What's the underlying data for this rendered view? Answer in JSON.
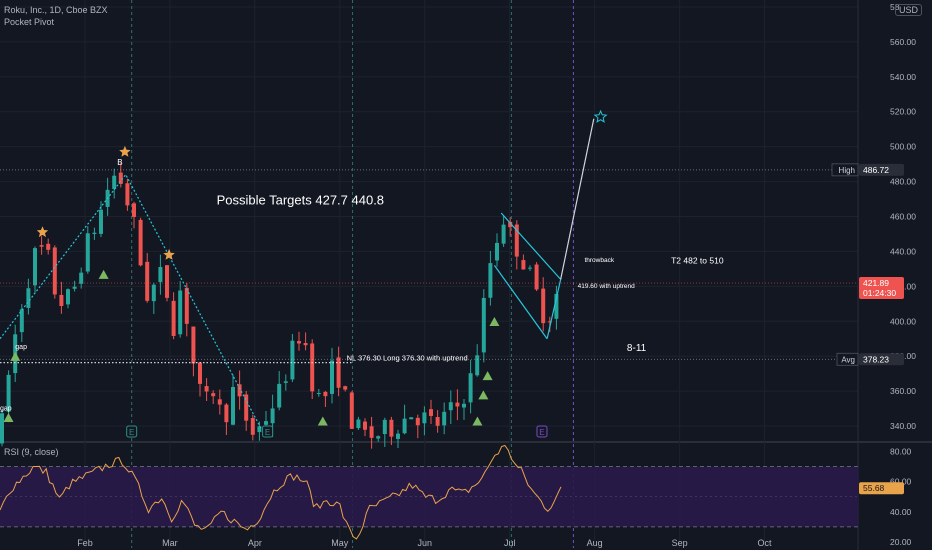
{
  "header": {
    "symbol_line": "Roku, Inc., 1D, Cboe BZX",
    "indicator_name": "Pocket Pivot",
    "currency": "USD",
    "rsi_legend": "RSI (9, close)"
  },
  "colors": {
    "background": "#131722",
    "up": "#26a69a",
    "down": "#ef5350",
    "rsi_line": "#e9a34b",
    "rsi_band": "#2a1a4a",
    "trendline": "#26c6da",
    "projection": "#d1d4dc",
    "star": "#e9a34b",
    "triangle": "#7cb862"
  },
  "chart_data": [
    {
      "type": "candlestick",
      "title": "Roku, Inc., 1D, Cboe BZX",
      "x_ticks": [
        "Feb",
        "Mar",
        "Apr",
        "May",
        "Jun",
        "Jul",
        "Aug",
        "Sep",
        "Oct"
      ],
      "y_ticks": [
        340,
        360,
        380,
        400,
        420,
        440,
        460,
        480,
        500,
        520,
        540,
        560,
        580
      ],
      "y_tick_labels": [
        "340.00",
        "360.00",
        "380.00",
        "400.00",
        "420.00",
        "440.00",
        "460.00",
        "480.00",
        "500.00",
        "520.00",
        "540.00",
        "560.00",
        "58"
      ],
      "ylim": [
        332,
        584
      ],
      "x_range_months": [
        0,
        10.1
      ],
      "pivots": [
        {
          "t": 0.0,
          "p": 332
        },
        {
          "t": 0.05,
          "p": 352
        },
        {
          "t": 0.12,
          "p": 375
        },
        {
          "t": 0.2,
          "p": 398
        },
        {
          "t": 0.3,
          "p": 420
        },
        {
          "t": 0.38,
          "p": 432
        },
        {
          "t": 0.46,
          "p": 446
        },
        {
          "t": 0.53,
          "p": 432
        },
        {
          "t": 0.6,
          "p": 438
        },
        {
          "t": 0.68,
          "p": 402
        },
        {
          "t": 0.76,
          "p": 420
        },
        {
          "t": 0.83,
          "p": 408
        },
        {
          "t": 0.9,
          "p": 425
        },
        {
          "t": 0.98,
          "p": 438
        },
        {
          "t": 1.08,
          "p": 450
        },
        {
          "t": 1.18,
          "p": 462
        },
        {
          "t": 1.28,
          "p": 478
        },
        {
          "t": 1.38,
          "p": 486
        },
        {
          "t": 1.48,
          "p": 472
        },
        {
          "t": 1.58,
          "p": 454
        },
        {
          "t": 1.66,
          "p": 432
        },
        {
          "t": 1.74,
          "p": 414
        },
        {
          "t": 1.84,
          "p": 422
        },
        {
          "t": 1.92,
          "p": 428
        },
        {
          "t": 2.0,
          "p": 408
        },
        {
          "t": 2.06,
          "p": 395
        },
        {
          "t": 2.12,
          "p": 418
        },
        {
          "t": 2.2,
          "p": 402
        },
        {
          "t": 2.3,
          "p": 368
        },
        {
          "t": 2.4,
          "p": 350
        },
        {
          "t": 2.52,
          "p": 362
        },
        {
          "t": 2.62,
          "p": 342
        },
        {
          "t": 2.74,
          "p": 360
        },
        {
          "t": 2.86,
          "p": 348
        },
        {
          "t": 2.98,
          "p": 336
        },
        {
          "t": 3.08,
          "p": 340
        },
        {
          "t": 3.2,
          "p": 352
        },
        {
          "t": 3.3,
          "p": 360
        },
        {
          "t": 3.42,
          "p": 380
        },
        {
          "t": 3.52,
          "p": 392
        },
        {
          "t": 3.6,
          "p": 386
        },
        {
          "t": 3.7,
          "p": 360
        },
        {
          "t": 3.8,
          "p": 352
        },
        {
          "t": 3.9,
          "p": 372
        },
        {
          "t": 4.0,
          "p": 368
        },
        {
          "t": 4.1,
          "p": 348
        },
        {
          "t": 4.2,
          "p": 338
        },
        {
          "t": 4.35,
          "p": 334
        },
        {
          "t": 4.5,
          "p": 336
        },
        {
          "t": 4.7,
          "p": 342
        },
        {
          "t": 4.85,
          "p": 348
        },
        {
          "t": 5.0,
          "p": 344
        },
        {
          "t": 5.12,
          "p": 340
        },
        {
          "t": 5.25,
          "p": 346
        },
        {
          "t": 5.4,
          "p": 352
        },
        {
          "t": 5.55,
          "p": 368
        },
        {
          "t": 5.65,
          "p": 392
        },
        {
          "t": 5.75,
          "p": 430
        },
        {
          "t": 5.85,
          "p": 448
        },
        {
          "t": 5.93,
          "p": 460
        },
        {
          "t": 6.03,
          "p": 446
        },
        {
          "t": 6.12,
          "p": 440
        },
        {
          "t": 6.2,
          "p": 430
        },
        {
          "t": 6.28,
          "p": 420
        },
        {
          "t": 6.36,
          "p": 410
        },
        {
          "t": 6.44,
          "p": 400
        },
        {
          "t": 6.52,
          "p": 412
        },
        {
          "t": 6.6,
          "p": 420
        }
      ],
      "price_lines": [
        {
          "value": 486.72,
          "label": "High",
          "price_label": "486.72",
          "color": "#d1d4dc",
          "bg": "#131722",
          "style": "dotted"
        },
        {
          "value": 421.89,
          "label": "",
          "price_label": "421.89",
          "sub_label": "01:24:30",
          "color": "#ef5350",
          "bg": "#ef5350",
          "style": "dotted"
        },
        {
          "value": 378.23,
          "label": "Avg",
          "price_label": "378.23",
          "color": "#d1d4dc",
          "bg": "#131722",
          "style": "dotted"
        }
      ],
      "earnings_markers": [
        {
          "t": 1.55,
          "label": "E"
        },
        {
          "t": 3.15,
          "label": "E"
        },
        {
          "t": 6.38,
          "label": "E"
        }
      ],
      "vertical_dashed_t": [
        1.55,
        4.15,
        6.02,
        6.75
      ],
      "neckline": {
        "value": 376.3,
        "t_start": 0.0,
        "t_end": 4.15
      },
      "trend_lines": [
        {
          "points": [
            [
              0.0,
              390
            ],
            [
              1.48,
              484
            ],
            [
              3.08,
              338
            ]
          ]
        },
        {
          "points": [
            [
              5.9,
              462
            ],
            [
              6.6,
              424
            ]
          ]
        },
        {
          "points": [
            [
              5.82,
              432
            ],
            [
              6.44,
              390
            ]
          ]
        },
        {
          "points": [
            [
              6.44,
              390
            ],
            [
              6.6,
              424
            ]
          ]
        }
      ],
      "projection_line": {
        "points": [
          [
            6.6,
            424
          ],
          [
            6.99,
            516
          ]
        ]
      },
      "stars": [
        {
          "t": 0.5,
          "p": 451
        },
        {
          "t": 1.47,
          "p": 497
        },
        {
          "t": 1.99,
          "p": 438
        },
        {
          "t": 7.07,
          "p": 517,
          "hollow": true
        }
      ],
      "triangles": [
        {
          "t": 0.1,
          "p": 344
        },
        {
          "t": 0.18,
          "p": 379
        },
        {
          "t": 1.22,
          "p": 426
        },
        {
          "t": 3.8,
          "p": 342
        },
        {
          "t": 5.62,
          "p": 342
        },
        {
          "t": 5.69,
          "p": 357
        },
        {
          "t": 5.74,
          "p": 368
        },
        {
          "t": 5.82,
          "p": 399
        }
      ],
      "annotations": [
        {
          "text": "Possible Targets  427.7   440.8",
          "t": 2.55,
          "p": 467,
          "size": 13
        },
        {
          "text": "T2  482 to 510",
          "t": 7.9,
          "p": 433,
          "size": 8.5
        },
        {
          "text": "throwback",
          "t": 6.88,
          "p": 434,
          "size": 6.5
        },
        {
          "text": "419.60 with uptrend",
          "t": 6.8,
          "p": 419,
          "size": 6.5
        },
        {
          "text": "NL 376.30  Long 376.30 with uptrend",
          "t": 4.08,
          "p": 377.5,
          "size": 7.5
        },
        {
          "text": "8-11",
          "t": 7.38,
          "p": 383,
          "size": 10
        },
        {
          "text": "B",
          "t": 1.38,
          "p": 489.5,
          "size": 8
        },
        {
          "text": "gap",
          "t": 0.18,
          "p": 384,
          "size": 7
        },
        {
          "text": "gap",
          "t": 0.0,
          "p": 349,
          "size": 7
        }
      ]
    },
    {
      "type": "line",
      "title": "RSI (9, close)",
      "ylim": [
        16,
        85
      ],
      "y_ticks": [
        20,
        40,
        60,
        80
      ],
      "y_tick_labels": [
        "20.00",
        "40.00",
        "60.00",
        "80.00"
      ],
      "bands": [
        30,
        70
      ],
      "current_value": 55.68,
      "current_label": "55.68",
      "pivots": [
        {
          "t": 0.0,
          "p": 40
        },
        {
          "t": 0.12,
          "p": 55
        },
        {
          "t": 0.25,
          "p": 62
        },
        {
          "t": 0.4,
          "p": 70
        },
        {
          "t": 0.55,
          "p": 66
        },
        {
          "t": 0.7,
          "p": 48
        },
        {
          "t": 0.82,
          "p": 58
        },
        {
          "t": 0.95,
          "p": 62
        },
        {
          "t": 1.1,
          "p": 66
        },
        {
          "t": 1.3,
          "p": 72
        },
        {
          "t": 1.45,
          "p": 74
        },
        {
          "t": 1.6,
          "p": 60
        },
        {
          "t": 1.75,
          "p": 42
        },
        {
          "t": 1.9,
          "p": 50
        },
        {
          "t": 2.02,
          "p": 36
        },
        {
          "t": 2.15,
          "p": 48
        },
        {
          "t": 2.3,
          "p": 30
        },
        {
          "t": 2.45,
          "p": 28
        },
        {
          "t": 2.6,
          "p": 40
        },
        {
          "t": 2.75,
          "p": 34
        },
        {
          "t": 2.9,
          "p": 28
        },
        {
          "t": 3.05,
          "p": 36
        },
        {
          "t": 3.2,
          "p": 52
        },
        {
          "t": 3.32,
          "p": 60
        },
        {
          "t": 3.45,
          "p": 64
        },
        {
          "t": 3.6,
          "p": 60
        },
        {
          "t": 3.72,
          "p": 42
        },
        {
          "t": 3.85,
          "p": 48
        },
        {
          "t": 4.0,
          "p": 44
        },
        {
          "t": 4.1,
          "p": 28
        },
        {
          "t": 4.2,
          "p": 22
        },
        {
          "t": 4.35,
          "p": 42
        },
        {
          "t": 4.5,
          "p": 46
        },
        {
          "t": 4.7,
          "p": 52
        },
        {
          "t": 4.85,
          "p": 58
        },
        {
          "t": 5.0,
          "p": 50
        },
        {
          "t": 5.15,
          "p": 48
        },
        {
          "t": 5.3,
          "p": 55
        },
        {
          "t": 5.45,
          "p": 52
        },
        {
          "t": 5.6,
          "p": 58
        },
        {
          "t": 5.7,
          "p": 64
        },
        {
          "t": 5.8,
          "p": 76
        },
        {
          "t": 5.9,
          "p": 82
        },
        {
          "t": 5.97,
          "p": 84
        },
        {
          "t": 6.05,
          "p": 72
        },
        {
          "t": 6.15,
          "p": 66
        },
        {
          "t": 6.25,
          "p": 55
        },
        {
          "t": 6.35,
          "p": 48
        },
        {
          "t": 6.45,
          "p": 42
        },
        {
          "t": 6.55,
          "p": 50
        },
        {
          "t": 6.62,
          "p": 55.68
        }
      ]
    }
  ]
}
